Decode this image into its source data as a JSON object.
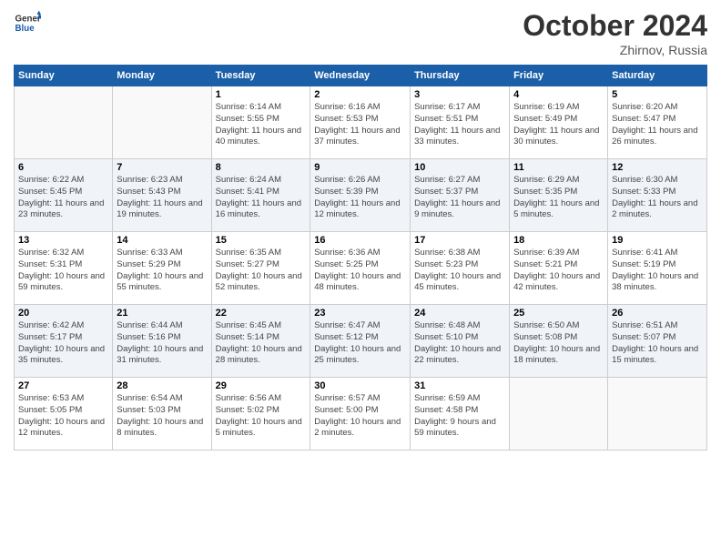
{
  "header": {
    "logo_line1": "General",
    "logo_line2": "Blue",
    "month": "October 2024",
    "location": "Zhirnov, Russia"
  },
  "weekdays": [
    "Sunday",
    "Monday",
    "Tuesday",
    "Wednesday",
    "Thursday",
    "Friday",
    "Saturday"
  ],
  "weeks": [
    [
      {
        "day": "",
        "info": ""
      },
      {
        "day": "",
        "info": ""
      },
      {
        "day": "1",
        "info": "Sunrise: 6:14 AM\nSunset: 5:55 PM\nDaylight: 11 hours and 40 minutes."
      },
      {
        "day": "2",
        "info": "Sunrise: 6:16 AM\nSunset: 5:53 PM\nDaylight: 11 hours and 37 minutes."
      },
      {
        "day": "3",
        "info": "Sunrise: 6:17 AM\nSunset: 5:51 PM\nDaylight: 11 hours and 33 minutes."
      },
      {
        "day": "4",
        "info": "Sunrise: 6:19 AM\nSunset: 5:49 PM\nDaylight: 11 hours and 30 minutes."
      },
      {
        "day": "5",
        "info": "Sunrise: 6:20 AM\nSunset: 5:47 PM\nDaylight: 11 hours and 26 minutes."
      }
    ],
    [
      {
        "day": "6",
        "info": "Sunrise: 6:22 AM\nSunset: 5:45 PM\nDaylight: 11 hours and 23 minutes."
      },
      {
        "day": "7",
        "info": "Sunrise: 6:23 AM\nSunset: 5:43 PM\nDaylight: 11 hours and 19 minutes."
      },
      {
        "day": "8",
        "info": "Sunrise: 6:24 AM\nSunset: 5:41 PM\nDaylight: 11 hours and 16 minutes."
      },
      {
        "day": "9",
        "info": "Sunrise: 6:26 AM\nSunset: 5:39 PM\nDaylight: 11 hours and 12 minutes."
      },
      {
        "day": "10",
        "info": "Sunrise: 6:27 AM\nSunset: 5:37 PM\nDaylight: 11 hours and 9 minutes."
      },
      {
        "day": "11",
        "info": "Sunrise: 6:29 AM\nSunset: 5:35 PM\nDaylight: 11 hours and 5 minutes."
      },
      {
        "day": "12",
        "info": "Sunrise: 6:30 AM\nSunset: 5:33 PM\nDaylight: 11 hours and 2 minutes."
      }
    ],
    [
      {
        "day": "13",
        "info": "Sunrise: 6:32 AM\nSunset: 5:31 PM\nDaylight: 10 hours and 59 minutes."
      },
      {
        "day": "14",
        "info": "Sunrise: 6:33 AM\nSunset: 5:29 PM\nDaylight: 10 hours and 55 minutes."
      },
      {
        "day": "15",
        "info": "Sunrise: 6:35 AM\nSunset: 5:27 PM\nDaylight: 10 hours and 52 minutes."
      },
      {
        "day": "16",
        "info": "Sunrise: 6:36 AM\nSunset: 5:25 PM\nDaylight: 10 hours and 48 minutes."
      },
      {
        "day": "17",
        "info": "Sunrise: 6:38 AM\nSunset: 5:23 PM\nDaylight: 10 hours and 45 minutes."
      },
      {
        "day": "18",
        "info": "Sunrise: 6:39 AM\nSunset: 5:21 PM\nDaylight: 10 hours and 42 minutes."
      },
      {
        "day": "19",
        "info": "Sunrise: 6:41 AM\nSunset: 5:19 PM\nDaylight: 10 hours and 38 minutes."
      }
    ],
    [
      {
        "day": "20",
        "info": "Sunrise: 6:42 AM\nSunset: 5:17 PM\nDaylight: 10 hours and 35 minutes."
      },
      {
        "day": "21",
        "info": "Sunrise: 6:44 AM\nSunset: 5:16 PM\nDaylight: 10 hours and 31 minutes."
      },
      {
        "day": "22",
        "info": "Sunrise: 6:45 AM\nSunset: 5:14 PM\nDaylight: 10 hours and 28 minutes."
      },
      {
        "day": "23",
        "info": "Sunrise: 6:47 AM\nSunset: 5:12 PM\nDaylight: 10 hours and 25 minutes."
      },
      {
        "day": "24",
        "info": "Sunrise: 6:48 AM\nSunset: 5:10 PM\nDaylight: 10 hours and 22 minutes."
      },
      {
        "day": "25",
        "info": "Sunrise: 6:50 AM\nSunset: 5:08 PM\nDaylight: 10 hours and 18 minutes."
      },
      {
        "day": "26",
        "info": "Sunrise: 6:51 AM\nSunset: 5:07 PM\nDaylight: 10 hours and 15 minutes."
      }
    ],
    [
      {
        "day": "27",
        "info": "Sunrise: 6:53 AM\nSunset: 5:05 PM\nDaylight: 10 hours and 12 minutes."
      },
      {
        "day": "28",
        "info": "Sunrise: 6:54 AM\nSunset: 5:03 PM\nDaylight: 10 hours and 8 minutes."
      },
      {
        "day": "29",
        "info": "Sunrise: 6:56 AM\nSunset: 5:02 PM\nDaylight: 10 hours and 5 minutes."
      },
      {
        "day": "30",
        "info": "Sunrise: 6:57 AM\nSunset: 5:00 PM\nDaylight: 10 hours and 2 minutes."
      },
      {
        "day": "31",
        "info": "Sunrise: 6:59 AM\nSunset: 4:58 PM\nDaylight: 9 hours and 59 minutes."
      },
      {
        "day": "",
        "info": ""
      },
      {
        "day": "",
        "info": ""
      }
    ]
  ]
}
